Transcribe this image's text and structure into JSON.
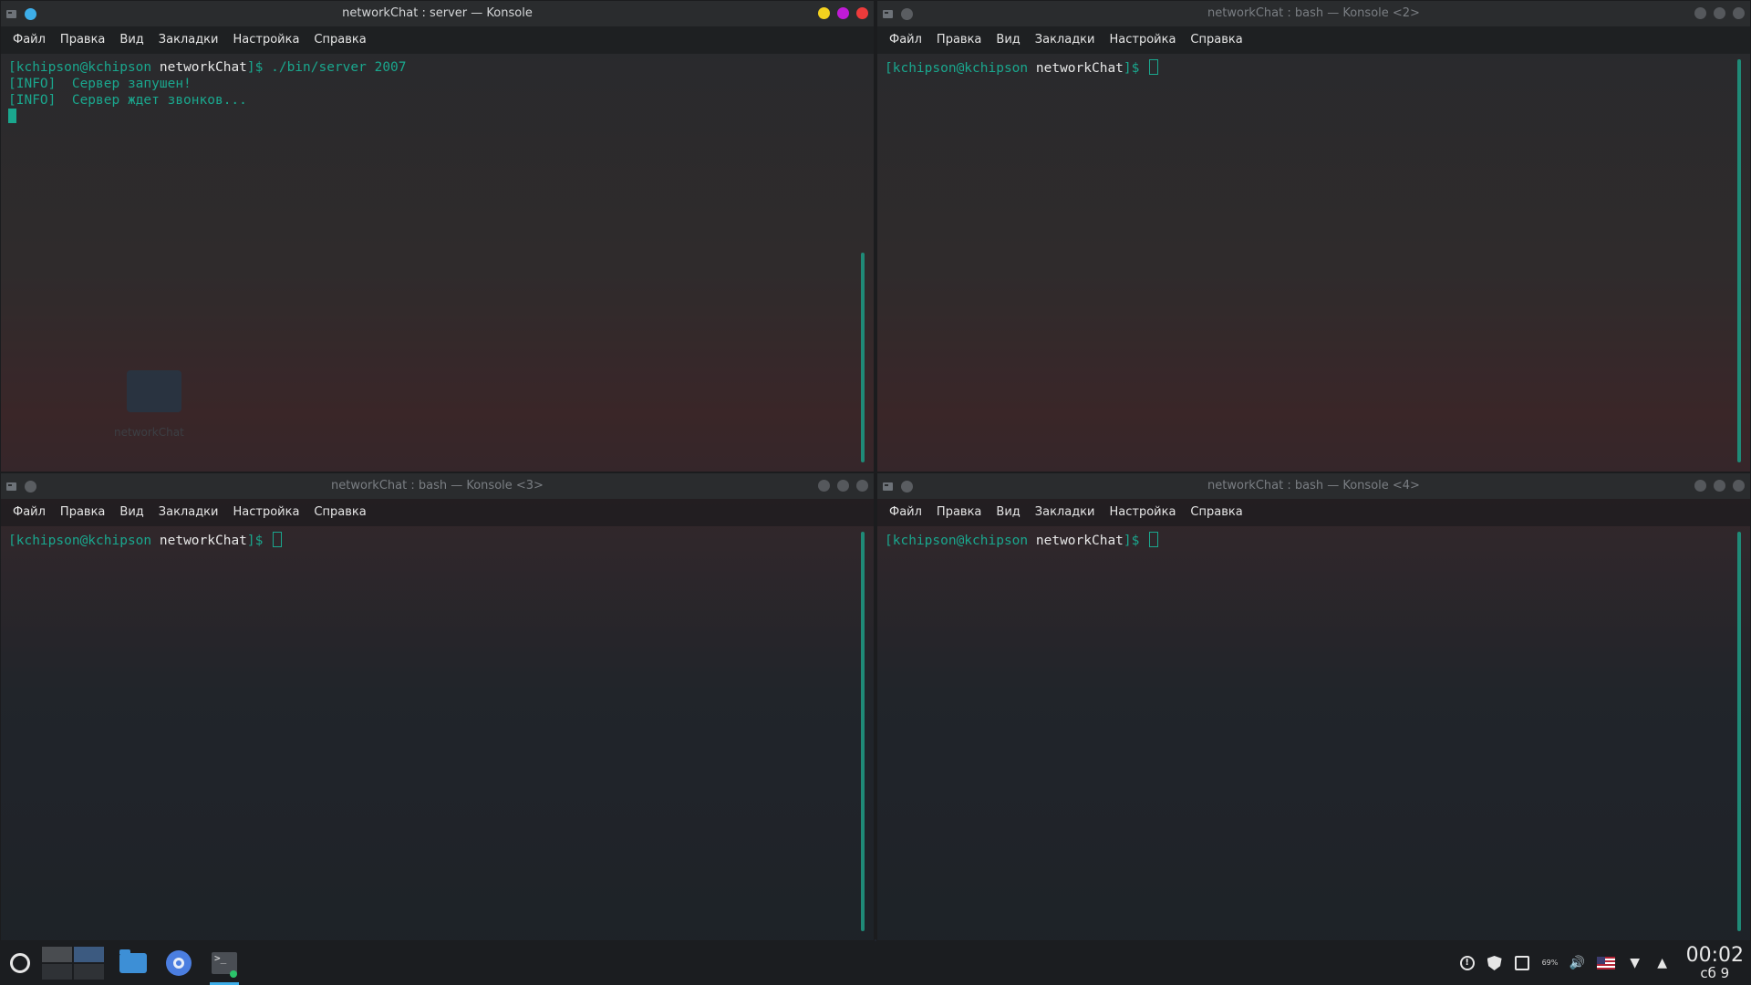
{
  "menu": [
    "Файл",
    "Правка",
    "Вид",
    "Закладки",
    "Настройка",
    "Справка"
  ],
  "windows": [
    {
      "title": "networkChat : server — Konsole",
      "active": true,
      "prompt": {
        "user": "[kchipson@kchipson ",
        "dir": "networkChat",
        "tail": "]$ ",
        "cmd": "./bin/server 2007"
      },
      "output": [
        "[INFO]  Сервер запушен!",
        "[INFO]  Сервер ждет звонков..."
      ]
    },
    {
      "title": "networkChat : bash — Konsole <2>",
      "active": false,
      "prompt": {
        "user": "[kchipson@kchipson ",
        "dir": "networkChat",
        "tail": "]$ ",
        "cmd": ""
      }
    },
    {
      "title": "networkChat : bash — Konsole <3>",
      "active": false,
      "prompt": {
        "user": "[kchipson@kchipson ",
        "dir": "networkChat",
        "tail": "]$ ",
        "cmd": ""
      }
    },
    {
      "title": "networkChat : bash — Konsole <4>",
      "active": false,
      "prompt": {
        "user": "[kchipson@kchipson ",
        "dir": "networkChat",
        "tail": "]$ ",
        "cmd": ""
      }
    }
  ],
  "desktop": {
    "folder_label": "networkChat"
  },
  "taskbar": {
    "clock_time": "00:02",
    "clock_date": "сб 9",
    "battery_label": "69%",
    "tray_icons": [
      "notification-icon",
      "shield-icon",
      "clipboard-icon",
      "battery-icon",
      "volume-icon",
      "us-flag-icon",
      "wifi-icon",
      "expand-tray-icon"
    ],
    "colors": {
      "accent": "#3daee9",
      "terminal_green": "#1aa78e"
    }
  }
}
